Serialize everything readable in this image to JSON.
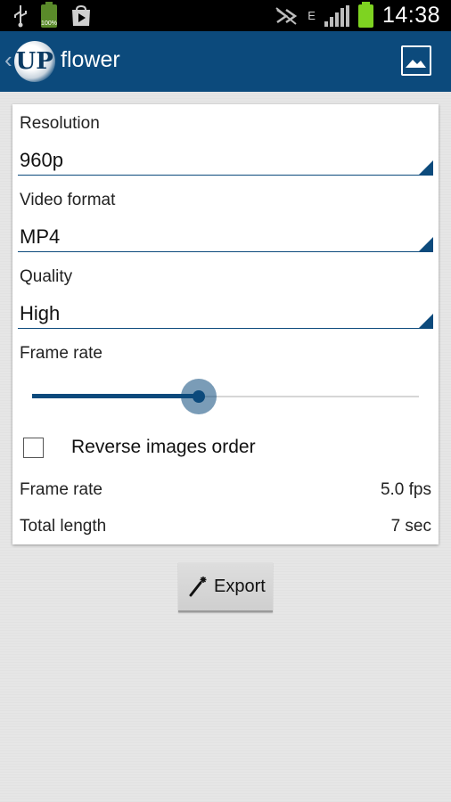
{
  "statusbar": {
    "battery_small_label": "100%",
    "time": "14:38",
    "network_label": "E",
    "icons": [
      "usb-icon",
      "battery-icon",
      "play-store-icon",
      "nfc-muted-icon",
      "network-type-icon",
      "signal-icon",
      "battery-icon"
    ]
  },
  "actionbar": {
    "logo_text": "UP",
    "title": "flower",
    "colors": {
      "background": "#0c4a7c"
    }
  },
  "settings": {
    "resolution": {
      "label": "Resolution",
      "value": "960p"
    },
    "video_format": {
      "label": "Video format",
      "value": "MP4"
    },
    "quality": {
      "label": "Quality",
      "value": "High"
    },
    "frame_rate_slider": {
      "label": "Frame rate",
      "value_fraction": 0.43
    },
    "reverse_order": {
      "label": "Reverse images order",
      "checked": false
    },
    "summary": {
      "frame_rate_label": "Frame rate",
      "frame_rate_value": "5.0 fps",
      "total_length_label": "Total length",
      "total_length_value": "7 sec"
    }
  },
  "export_button": {
    "label": "Export",
    "icon": "magic-wand-icon"
  },
  "colors": {
    "accent": "#0c4a7c",
    "status_battery": "#7ed321"
  }
}
